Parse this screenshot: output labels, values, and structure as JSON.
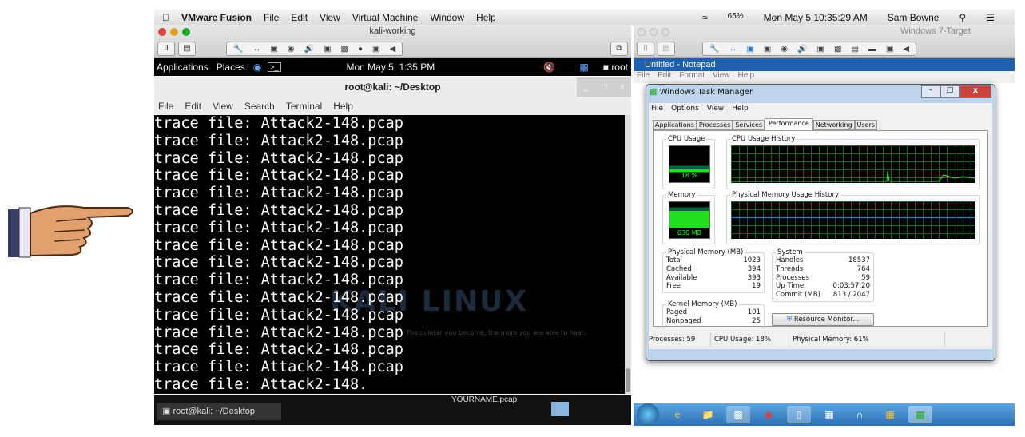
{
  "mac_menubar": {
    "app": "VMware Fusion",
    "menus": [
      "File",
      "Edit",
      "View",
      "Virtual Machine",
      "Window",
      "Help"
    ],
    "battery": "65%",
    "datetime": "Mon May 5  10:35:29 AM",
    "user": "Sam Bowne"
  },
  "left_vm": {
    "title": "kali-working",
    "kali_panel": {
      "applications": "Applications",
      "places": "Places",
      "clock": "Mon May  5,  1:35 PM",
      "user": "root"
    },
    "terminal": {
      "title": "root@kali: ~/Desktop",
      "menu": [
        "File",
        "Edit",
        "View",
        "Search",
        "Terminal",
        "Help"
      ],
      "lines": [
        "trace file: Attack2-148.pcap",
        "trace file: Attack2-148.pcap",
        "trace file: Attack2-148.pcap",
        "trace file: Attack2-148.pcap",
        "trace file: Attack2-148.pcap",
        "trace file: Attack2-148.pcap",
        "trace file: Attack2-148.pcap",
        "trace file: Attack2-148.pcap",
        "trace file: Attack2-148.pcap",
        "trace file: Attack2-148.pcap",
        "trace file: Attack2-148.pcap",
        "trace file: Attack2-148.pcap",
        "trace file: Attack2-148.pcap",
        "trace file: Attack2-148.pcap",
        "trace file: Attack2-148.pcap",
        "trace file: Attack2-148."
      ],
      "watermark": "KALI LINUX",
      "motto": "The quieter you become, the more you are able to hear."
    },
    "desktop_file": "YOURNAME.pcap",
    "taskbar_item": "root@kali: ~/Desktop"
  },
  "right_vm": {
    "title": "Windows 7-Target",
    "notepad": {
      "title": "Untitled - Notepad",
      "menu": [
        "File",
        "Edit",
        "Format",
        "View",
        "Help"
      ]
    },
    "task_manager": {
      "title": "Windows Task Manager",
      "menu": [
        "File",
        "Options",
        "View",
        "Help"
      ],
      "tabs": [
        "Applications",
        "Processes",
        "Services",
        "Performance",
        "Networking",
        "Users"
      ],
      "active_tab": "Performance",
      "cpu_usage_label": "CPU Usage",
      "cpu_usage": "18 %",
      "cpu_history_label": "CPU Usage History",
      "memory_label": "Memory",
      "memory": "630 MB",
      "memory_history_label": "Physical Memory Usage History",
      "physical_memory": {
        "label": "Physical Memory (MB)",
        "rows": [
          [
            "Total",
            "1023"
          ],
          [
            "Cached",
            "394"
          ],
          [
            "Available",
            "393"
          ],
          [
            "Free",
            "19"
          ]
        ]
      },
      "kernel_memory": {
        "label": "Kernel Memory (MB)",
        "rows": [
          [
            "Paged",
            "101"
          ],
          [
            "Nonpaged",
            "25"
          ]
        ]
      },
      "system": {
        "label": "System",
        "rows": [
          [
            "Handles",
            "18537"
          ],
          [
            "Threads",
            "764"
          ],
          [
            "Processes",
            "59"
          ],
          [
            "Up Time",
            "0:03:57:20"
          ],
          [
            "Commit (MB)",
            "813 / 2047"
          ]
        ]
      },
      "resource_monitor": "Resource Monitor...",
      "status": {
        "processes": "Processes: 59",
        "cpu": "CPU Usage: 18%",
        "memory": "Physical Memory: 61%"
      }
    }
  },
  "colors": {
    "graph_line": "#22ff22",
    "memory_line": "#1e7fd8",
    "notepad_title": "#1e5fae"
  }
}
